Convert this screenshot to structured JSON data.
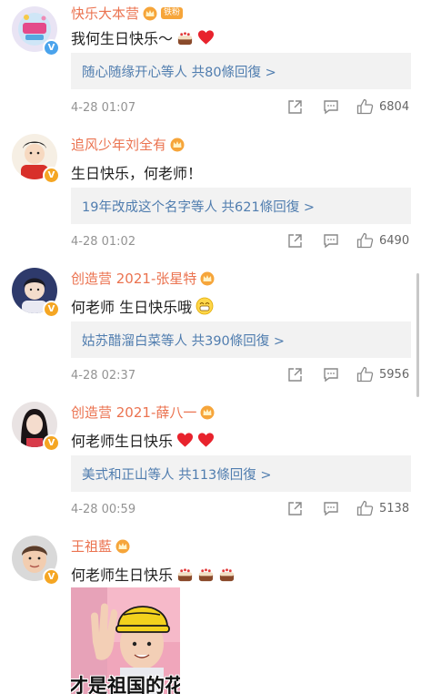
{
  "comments": [
    {
      "username": "快乐大本营",
      "fan_badge": "铁粉",
      "verify": "blue",
      "text": "我何生日快乐～",
      "emojis": [
        "cake",
        "heart"
      ],
      "reply_summary": "随心随缘开心等人 共80條回復 >",
      "time": "4-28 01:07",
      "likes": "6804"
    },
    {
      "username": "追风少年刘全有",
      "verify": "gold",
      "text": "生日快乐，何老师！",
      "emojis": [],
      "reply_summary": "19年改成这个名字等人 共621條回復 >",
      "time": "4-28 01:02",
      "likes": "6490"
    },
    {
      "username": "创造营 2021-张星特",
      "verify": "gold",
      "text": "何老师 生日快乐哦",
      "emojis": [
        "grin"
      ],
      "reply_summary": "姑苏醋溜白菜等人 共390條回復 >",
      "time": "4-28 02:37",
      "likes": "5956"
    },
    {
      "username": "创造营 2021-薛八一",
      "verify": "gold",
      "text": "何老师生日快乐",
      "emojis": [
        "heart",
        "heart"
      ],
      "reply_summary": "美式和正山等人 共113條回復 >",
      "time": "4-28 00:59",
      "likes": "5138"
    },
    {
      "username": "王祖藍",
      "verify": "gold",
      "text": "何老师生日快乐",
      "emojis": [
        "cake",
        "cake",
        "cake"
      ],
      "photo_caption": "才是祖国的花"
    }
  ],
  "colors": {
    "username": "#eb7350",
    "link": "#507daf",
    "meta": "#939393",
    "reply_bg": "#f2f2f2",
    "heart": "#e8232d"
  },
  "icons": {
    "share": "share-icon",
    "comment": "comment-icon",
    "like": "like-icon",
    "crown": "crown-badge-icon",
    "verify": "verified-v-icon"
  }
}
